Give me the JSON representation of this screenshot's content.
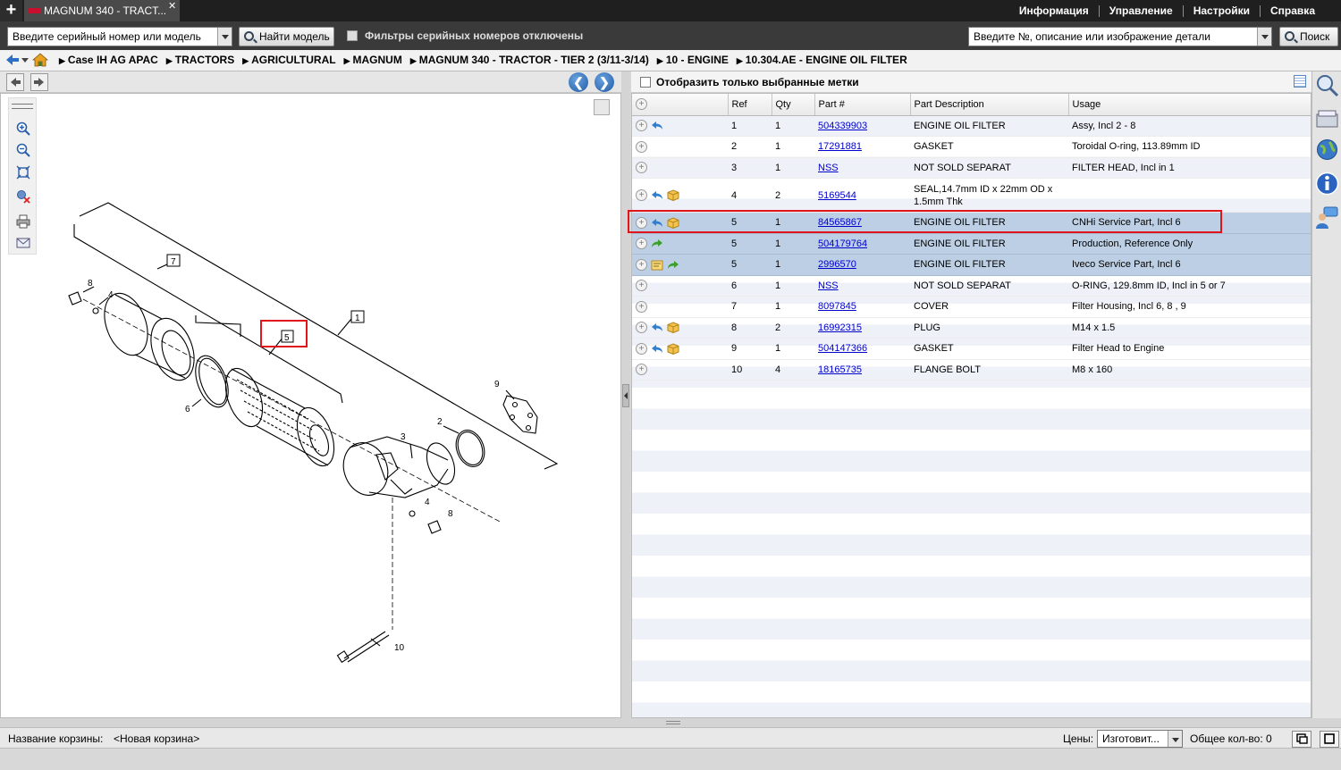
{
  "tab": {
    "title": "MAGNUM 340 - TRACT..."
  },
  "top_menu": [
    "Информация",
    "Управление",
    "Настройки",
    "Справка"
  ],
  "search": {
    "serial_placeholder": "Введите серийный номер или модель",
    "find_model_label": "Найти модель",
    "filter_label": "Фильтры серийных номеров отключены",
    "part_placeholder": "Введите №, описание или изображение детали",
    "search_label": "Поиск"
  },
  "breadcrumb": [
    "Case IH AG APAC",
    "TRACTORS",
    "AGRICULTURAL",
    "MAGNUM",
    "MAGNUM 340 - TRACTOR - TIER 2 (3/11-3/14)",
    "10 - ENGINE",
    "10.304.AE - ENGINE OIL FILTER"
  ],
  "parts_panel": {
    "show_selected_label": "Отобразить только выбранные метки",
    "columns": [
      "Ref",
      "Qty",
      "Part #",
      "Part Description",
      "Usage"
    ],
    "rows": [
      {
        "ref": "1",
        "qty": "1",
        "part": "504339903",
        "desc": "ENGINE OIL FILTER",
        "usage": "Assy, Incl 2 - 8",
        "icons": [
          "blue-arrow"
        ]
      },
      {
        "ref": "2",
        "qty": "1",
        "part": "17291881",
        "desc": "GASKET",
        "usage": "Toroidal O-ring, 113.89mm ID",
        "icons": []
      },
      {
        "ref": "3",
        "qty": "1",
        "part": "NSS",
        "desc": "NOT SOLD SEPARAT",
        "usage": "FILTER HEAD, Incl in 1",
        "icons": []
      },
      {
        "ref": "4",
        "qty": "2",
        "part": "5169544",
        "desc": "SEAL,14.7mm ID x 22mm OD x 1.5mm Thk",
        "usage": "",
        "icons": [
          "blue-arrow",
          "box"
        ]
      },
      {
        "ref": "5",
        "qty": "1",
        "part": "84565867",
        "desc": "ENGINE OIL FILTER",
        "usage": "CNHi Service Part, Incl 6",
        "icons": [
          "blue-arrow",
          "box"
        ],
        "selected": true
      },
      {
        "ref": "5",
        "qty": "1",
        "part": "504179764",
        "desc": "ENGINE OIL FILTER",
        "usage": "Production, Reference Only",
        "icons": [
          "green-arrow"
        ],
        "selected": true
      },
      {
        "ref": "5",
        "qty": "1",
        "part": "2996570",
        "desc": "ENGINE OIL FILTER",
        "usage": "Iveco Service Part, Incl 6",
        "icons": [
          "note",
          "green-arrow"
        ],
        "selected": true
      },
      {
        "ref": "6",
        "qty": "1",
        "part": "NSS",
        "desc": "NOT SOLD SEPARAT",
        "usage": "O-RING, 129.8mm ID, Incl in 5 or 7",
        "icons": []
      },
      {
        "ref": "7",
        "qty": "1",
        "part": "8097845",
        "desc": "COVER",
        "usage": "Filter Housing, Incl 6, 8 , 9",
        "icons": []
      },
      {
        "ref": "8",
        "qty": "2",
        "part": "16992315",
        "desc": "PLUG",
        "usage": "M14 x 1.5",
        "icons": [
          "blue-arrow",
          "box"
        ]
      },
      {
        "ref": "9",
        "qty": "1",
        "part": "504147366",
        "desc": "GASKET",
        "usage": "Filter Head to Engine",
        "icons": [
          "blue-arrow",
          "box"
        ]
      },
      {
        "ref": "10",
        "qty": "4",
        "part": "18165735",
        "desc": "FLANGE BOLT",
        "usage": "M8 x 160",
        "icons": []
      }
    ]
  },
  "diagram": {
    "callouts": [
      "1",
      "2",
      "3",
      "4",
      "4",
      "5",
      "6",
      "7",
      "8",
      "8",
      "9",
      "10"
    ]
  },
  "footer": {
    "basket_label": "Название корзины:",
    "basket_name": "<Новая корзина>",
    "prices_label": "Цены:",
    "prices_value": "Изготовит...",
    "total_label": "Общее кол-во: 0"
  },
  "colors": {
    "highlight": "#e0151b",
    "selected_row": "#bccfe4",
    "link": "#0000cc",
    "topbar": "#1f1f1f"
  }
}
